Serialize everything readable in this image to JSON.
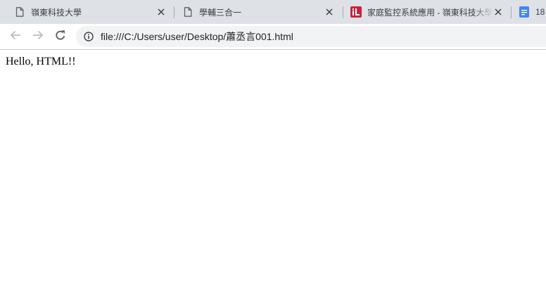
{
  "tabs": [
    {
      "title": "嶺東科技大學",
      "icon": "document-icon"
    },
    {
      "title": "學輔三合一",
      "icon": "document-icon"
    },
    {
      "title": "家庭監控系統應用 - 嶺東科技大學",
      "icon": "site-favicon"
    },
    {
      "title": "18",
      "icon": "google-docs-icon"
    }
  ],
  "toolbar": {
    "url": "file:///C:/Users/user/Desktop/蕭丞言001.html"
  },
  "page": {
    "text": "Hello, HTML!!"
  },
  "colors": {
    "tab_strip": "#dee1e6",
    "omnibox": "#f1f3f4",
    "favicon_red": "#c5243c",
    "docs_blue": "#4285f4"
  }
}
